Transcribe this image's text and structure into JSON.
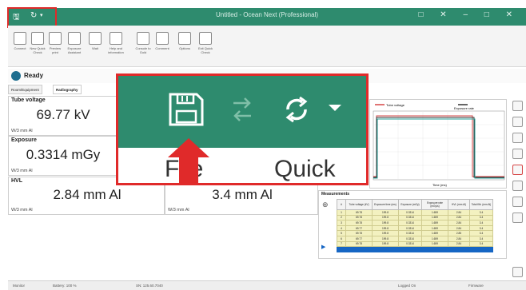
{
  "app": {
    "title": "Untitled - Ocean Next (Professional)"
  },
  "window_controls": "□  ✕  –  □  ✕",
  "ribbon": {
    "buttons": [
      {
        "label": "Connect"
      },
      {
        "label": "New Quick Check"
      },
      {
        "label": "Preview print"
      },
      {
        "label": "Exposure Assistant"
      },
      {
        "label": "Wait"
      },
      {
        "label": "Help and information"
      },
      {
        "label": "Console to Gold"
      },
      {
        "label": "Comment"
      },
      {
        "label": "Options"
      },
      {
        "label": "Exit Quick Check"
      }
    ]
  },
  "status": {
    "text": "Ready"
  },
  "tabs": [
    {
      "label": "Room/Equipment"
    },
    {
      "label": "Radiography"
    }
  ],
  "readings": [
    {
      "title": "Tube voltage",
      "value": "69.77 kV",
      "unit": "W/3 mm Al"
    },
    {
      "title": "Exposure",
      "value": "0.3314 mGy",
      "unit": "W/3 mm Al"
    },
    {
      "title": "HVL",
      "value": "2.84 mm Al",
      "unit": "W/3 mm Al"
    },
    {
      "title": "",
      "value": "3.4 mm Al",
      "unit": "W/3 mm Al"
    }
  ],
  "chart": {
    "legend": [
      "Tube voltage",
      "Exposure rate"
    ],
    "xlabel": "Time (ms)",
    "colors": {
      "voltage": "#d64545",
      "exposure": "#2aa198",
      "dark": "#333333"
    }
  },
  "measurements": {
    "title": "Measurements",
    "columns": [
      "#",
      "Tube voltage (kV)",
      "Exposure time (ms)",
      "Exposure (mGy)",
      "Exposure rate (mGy/s)",
      "HVL (mm Al)",
      "Total filtr. (mm Al)"
    ],
    "rows": [
      [
        "1",
        "69.78",
        "199.8",
        "0.3314",
        "1.659",
        "2.84",
        "3.4"
      ],
      [
        "2",
        "69.78",
        "199.8",
        "0.3314",
        "1.659",
        "2.84",
        "3.4"
      ],
      [
        "3",
        "69.78",
        "199.8",
        "0.3314",
        "1.659",
        "2.84",
        "3.4"
      ],
      [
        "4",
        "69.77",
        "199.8",
        "0.3314",
        "1.659",
        "2.84",
        "3.4"
      ],
      [
        "5",
        "69.78",
        "199.8",
        "0.3314",
        "1.659",
        "2.85",
        "3.4"
      ],
      [
        "6",
        "69.77",
        "199.8",
        "0.3314",
        "1.659",
        "2.84",
        "3.4"
      ],
      [
        "7",
        "69.78",
        "199.8",
        "0.3314",
        "1.659",
        "2.84",
        "3.4"
      ]
    ]
  },
  "zoom": {
    "ribbon_labels": [
      "File",
      "Quick Ch"
    ]
  },
  "footer": {
    "items": [
      "Monitor",
      "Battery: 100 %",
      "SN: 125.60.7040",
      "Logged On",
      "Firmware"
    ]
  }
}
